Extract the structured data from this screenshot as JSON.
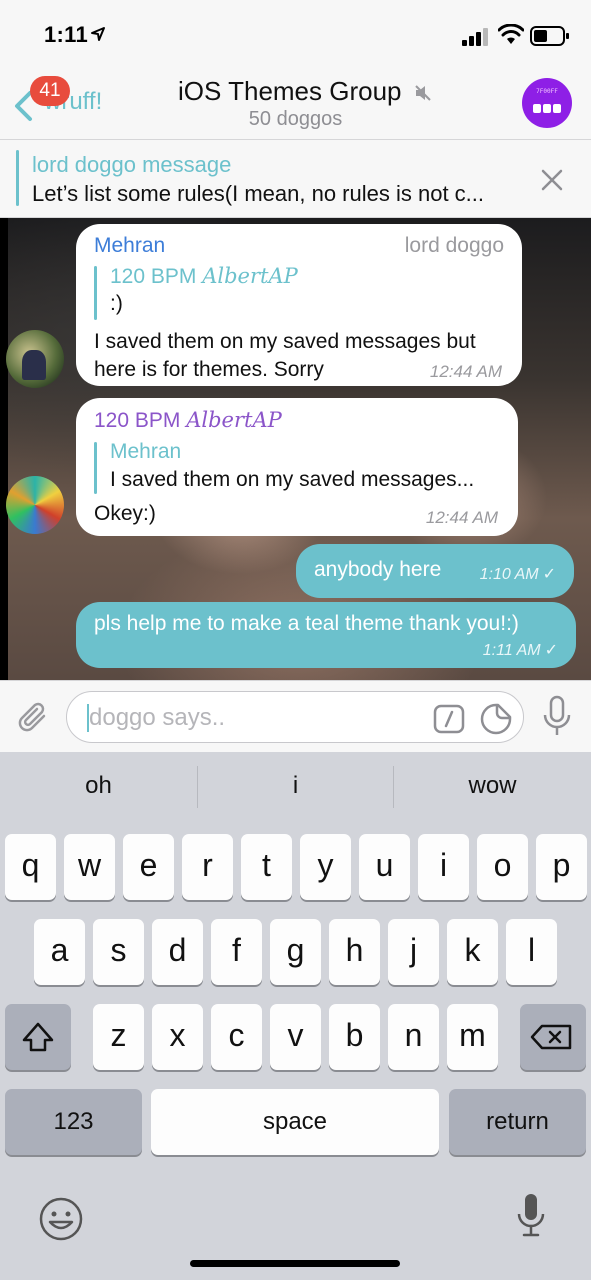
{
  "status_bar": {
    "time": "1:11"
  },
  "header": {
    "back_label": "wruff!",
    "unread_badge": "41",
    "title": "iOS Themes Group",
    "subtitle": "50 doggos",
    "avatar_label": "7F00FF"
  },
  "pinned": {
    "title": "lord doggo message",
    "text": "Let’s list some rules(I mean, no rules is not c..."
  },
  "messages": [
    {
      "sender": "Mehran",
      "role": "lord doggo",
      "reply_name": "120 BPM",
      "reply_name_script": "AlbertAP",
      "reply_text": ":)",
      "text_line1": "I saved them on my saved messages but",
      "text_line2": "here is for themes. Sorry",
      "time": "12:44 AM"
    },
    {
      "sender": "120 BPM",
      "sender_script": "AlbertAP",
      "reply_name": "Mehran",
      "reply_text": "I saved them on my saved messages...",
      "text": "Okey:)",
      "time": "12:44 AM"
    },
    {
      "text": "anybody here",
      "time": "1:10 AM"
    },
    {
      "text": "pls help me to make a teal theme thank you!:)",
      "time": "1:11 AM"
    }
  ],
  "input": {
    "placeholder": "doggo says.."
  },
  "keyboard": {
    "suggestions": [
      "oh",
      "i",
      "wow"
    ],
    "row1": [
      "q",
      "w",
      "e",
      "r",
      "t",
      "y",
      "u",
      "i",
      "o",
      "p"
    ],
    "row2": [
      "a",
      "s",
      "d",
      "f",
      "g",
      "h",
      "j",
      "k",
      "l"
    ],
    "row3": [
      "z",
      "x",
      "c",
      "v",
      "b",
      "n",
      "m"
    ],
    "numbers_label": "123",
    "space_label": "space",
    "return_label": "return"
  },
  "colors": {
    "accent_teal": "#6cc1cc",
    "badge_red": "#e84c3d",
    "sender_blue": "#3d7dd8",
    "sender_purple": "#8b55c9",
    "group_avatar_purple": "#8e1fe6"
  }
}
